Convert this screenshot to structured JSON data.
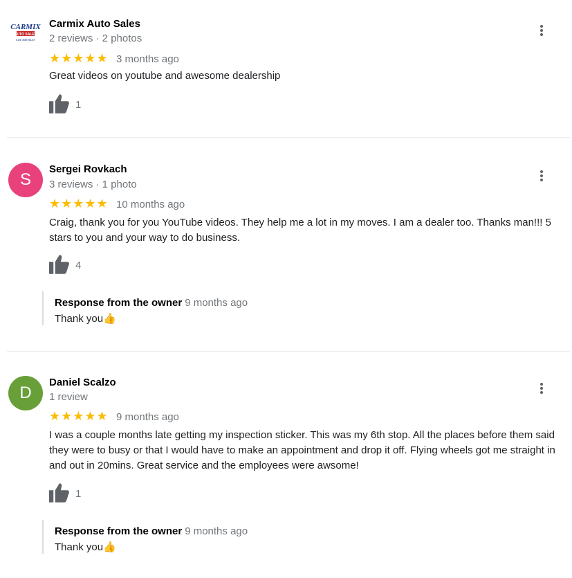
{
  "reviews": [
    {
      "name": "Carmix Auto Sales",
      "meta": "2 reviews · 2 photos",
      "avatar": {
        "type": "logo",
        "logo_top": "CARMIX",
        "logo_bottom": "AUTO SALES",
        "logo_phone": "434-305-9137"
      },
      "stars": "★★★★★",
      "rating": 5,
      "time": "3 months ago",
      "text": "Great videos on youtube and awesome dealership",
      "likes": "1"
    },
    {
      "name": "Sergei Rovkach",
      "meta": "3 reviews · 1 photo",
      "avatar": {
        "type": "letter",
        "letter": "S",
        "color": "#e8417b"
      },
      "stars": "★★★★★",
      "rating": 5,
      "time": "10 months ago",
      "text": "Craig, thank you for you YouTube videos. They help me a lot in my moves. I am a dealer too. Thanks man!!! 5 stars to you and your way to do business.",
      "likes": "4",
      "owner_response": {
        "label": "Response from the owner",
        "time": "9 months ago",
        "text": "Thank you",
        "emoji": "👍"
      }
    },
    {
      "name": "Daniel Scalzo",
      "meta": "1 review",
      "avatar": {
        "type": "letter",
        "letter": "D",
        "color": "#689f38"
      },
      "stars": "★★★★★",
      "rating": 5,
      "time": "9 months ago",
      "text": "I was a couple months late getting my inspection sticker. This was my 6th stop. All the places before them said they were to busy or that I  would have to make an appointment and drop it off. Flying wheels got me straight in and out in 20mins. Great service and the employees were awsome!",
      "likes": "1",
      "owner_response": {
        "label": "Response from the owner",
        "time": "9 months ago",
        "text": "Thank you",
        "emoji": "👍"
      }
    }
  ],
  "icons": {
    "like": "thumbs-up-icon",
    "more": "more-vert-icon"
  },
  "colors": {
    "star": "#fbbc04",
    "secondary_text": "#70757a",
    "icon": "#5f6368"
  }
}
